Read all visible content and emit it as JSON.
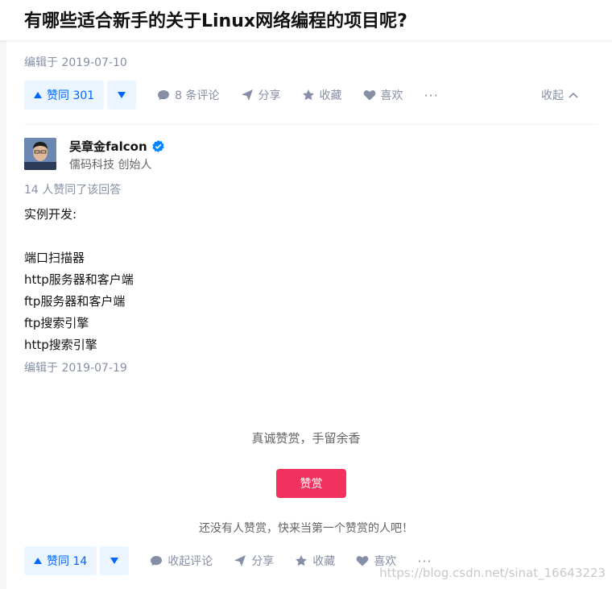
{
  "question": {
    "title": "有哪些适合新手的关于Linux网络编程的项目呢?"
  },
  "question_meta": {
    "edit_time": "编辑于 2019-07-10"
  },
  "question_actions": {
    "vote_up": "赞同 301",
    "comments": "8 条评论",
    "share": "分享",
    "collect": "收藏",
    "like": "喜欢",
    "more": "···",
    "collapse": "收起"
  },
  "answer": {
    "author": {
      "name": "吴章金falcon",
      "headline": "儒码科技 创始人",
      "verified_color": "#0084ff"
    },
    "votes_text": "14 人赞同了该回答",
    "content": [
      "实例开发:",
      "",
      "端口扫描器",
      "http服务器和客户端",
      "ftp服务器和客户端",
      "ftp搜索引擎",
      "http搜索引擎"
    ],
    "edit_time": "编辑于 2019-07-19"
  },
  "reward": {
    "tip": "真诚赞赏，手留余香",
    "button": "赞赏",
    "empty": "还没有人赞赏，快来当第一个赞赏的人吧！"
  },
  "answer_actions": {
    "vote_up": "赞同 14",
    "comments": "收起评论",
    "share": "分享",
    "collect": "收藏",
    "like": "喜欢",
    "more": "···"
  },
  "watermark": "https://blog.csdn.net/sinat_16643223",
  "colors": {
    "accent": "#0066ff",
    "vote_bg": "#ebf5ff",
    "reward": "#f1325e",
    "muted": "#8590a6"
  }
}
